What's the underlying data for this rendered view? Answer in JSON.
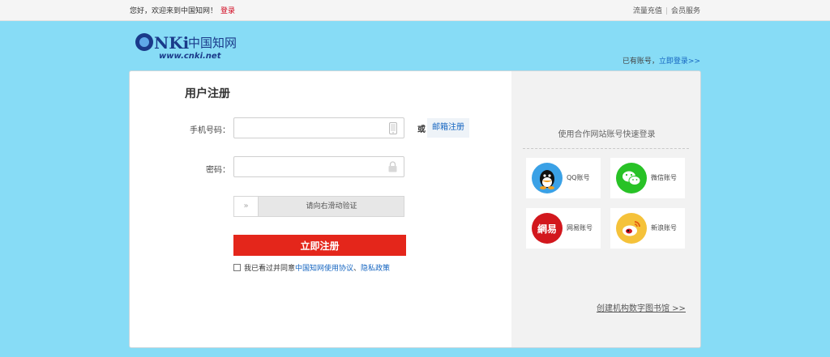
{
  "topbar": {
    "greeting": "您好，欢迎来到中国知网！",
    "login": "登录",
    "recharge": "流量充值",
    "member": "会员服务"
  },
  "logo": {
    "text_cn": "中国知网",
    "url": "www.cnki.net"
  },
  "header": {
    "have_account": "已有账号，",
    "login_now": "立即登录>>"
  },
  "form": {
    "title": "用户注册",
    "phone_label": "手机号码：",
    "or_text": "或",
    "email_register": "邮箱注册",
    "password_label": "密码：",
    "slider_hint": "请向右滑动验证",
    "slider_handle": "»",
    "submit": "立即注册",
    "agree_prefix": "我已看过并同意",
    "agreement_link": "中国知网使用协议",
    "separator": "、",
    "privacy_link": "隐私政策"
  },
  "quick_login": {
    "title": "使用合作网站账号快速登录",
    "items": [
      {
        "label": "QQ账号",
        "icon": "qq-icon",
        "color": "#3aa1e6"
      },
      {
        "label": "微信账号",
        "icon": "wechat-icon",
        "color": "#28c226"
      },
      {
        "label": "网易账号",
        "icon": "netease-icon",
        "color": "#d2171d"
      },
      {
        "label": "新浪账号",
        "icon": "weibo-icon",
        "color": "#f5c23a"
      }
    ]
  },
  "create_library": "创建机构数字图书馆 >>",
  "colors": {
    "background": "#87dcf6",
    "submit": "#e4261b",
    "link": "#1565c0"
  }
}
